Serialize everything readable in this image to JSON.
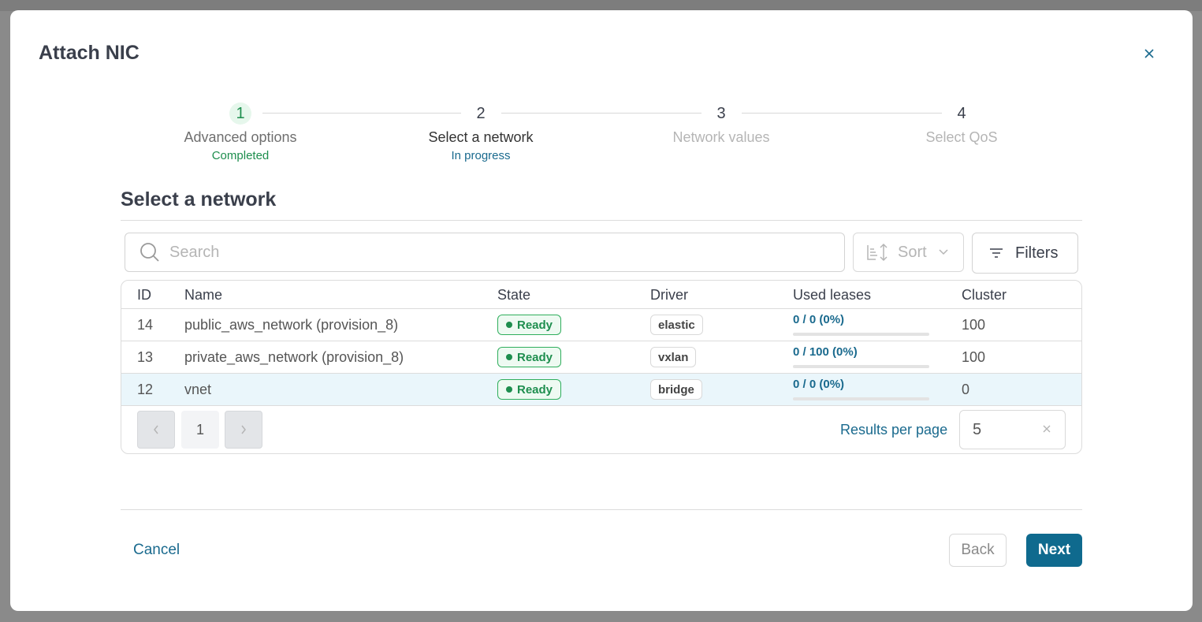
{
  "modal": {
    "title": "Attach NIC"
  },
  "stepper": {
    "steps": [
      {
        "number": "1",
        "label": "Advanced options",
        "status": "Completed"
      },
      {
        "number": "2",
        "label": "Select a network",
        "status": "In progress"
      },
      {
        "number": "3",
        "label": "Network values",
        "status": ""
      },
      {
        "number": "4",
        "label": "Select QoS",
        "status": ""
      }
    ]
  },
  "section": {
    "title": "Select a network"
  },
  "toolbar": {
    "search_placeholder": "Search",
    "sort_label": "Sort",
    "filters_label": "Filters"
  },
  "table": {
    "columns": {
      "id": "ID",
      "name": "Name",
      "state": "State",
      "driver": "Driver",
      "used_leases": "Used leases",
      "cluster": "Cluster"
    },
    "rows": [
      {
        "id": "14",
        "name": "public_aws_network (provision_8)",
        "state": "Ready",
        "driver": "elastic",
        "leases": "0 / 0 (0%)",
        "lease_fraction": 0,
        "cluster": "100"
      },
      {
        "id": "13",
        "name": "private_aws_network (provision_8)",
        "state": "Ready",
        "driver": "vxlan",
        "leases": "0 / 100 (0%)",
        "lease_fraction": 0,
        "cluster": "100"
      },
      {
        "id": "12",
        "name": "vnet",
        "state": "Ready",
        "driver": "bridge",
        "leases": "0 / 0 (0%)",
        "lease_fraction": 0,
        "cluster": "0"
      }
    ]
  },
  "pagination": {
    "current_page": "1",
    "results_per_page_label": "Results per page",
    "results_per_page_value": "5"
  },
  "footer": {
    "cancel_label": "Cancel",
    "back_label": "Back",
    "next_label": "Next"
  },
  "colors": {
    "accent": "#0f6a8e",
    "success": "#1e8e4e",
    "selected_row": "#eaf6fb"
  }
}
